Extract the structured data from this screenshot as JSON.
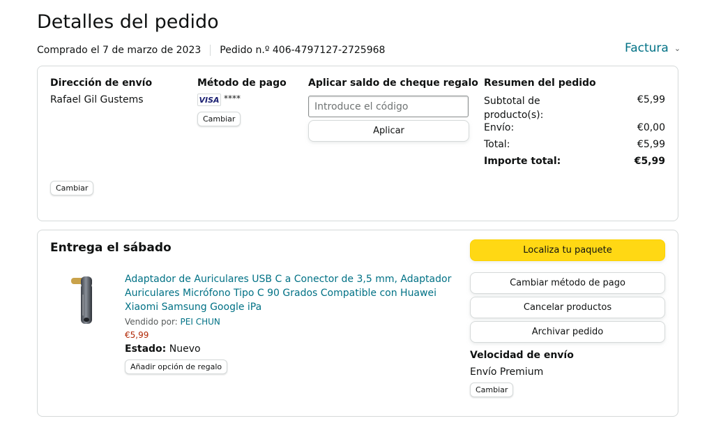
{
  "header": {
    "title": "Detalles del pedido",
    "purchased": "Comprado el 7 de marzo de 2023",
    "order_number": "Pedido n.º 406-4797127-2725968",
    "invoice_label": "Factura"
  },
  "shipping": {
    "heading": "Dirección de envío",
    "name": "Rafael Gil Gustems",
    "change_label": "Cambiar"
  },
  "payment": {
    "heading": "Método de pago",
    "card_brand": "VISA",
    "card_mask": "****",
    "change_label": "Cambiar"
  },
  "gift_card": {
    "heading": "Aplicar saldo de cheque regalo",
    "placeholder": "Introduce el código",
    "apply_label": "Aplicar"
  },
  "summary": {
    "heading": "Resumen del pedido",
    "rows": [
      {
        "label": "Subtotal de producto(s):",
        "value": "€5,99"
      },
      {
        "label": "Envío:",
        "value": "€0,00"
      },
      {
        "label": "Total:",
        "value": "€5,99"
      },
      {
        "label": "Importe total:",
        "value": "€5,99"
      }
    ]
  },
  "delivery": {
    "title": "Entrega el sábado",
    "product": {
      "title": "Adaptador de Auriculares USB C a Conector de 3,5 mm, Adaptador Auriculares Micrófono Tipo C 90 Grados Compatible con Huawei Xiaomi Samsung Google iPa",
      "sold_by_label": "Vendido por:",
      "seller": "PEI CHUN",
      "price": "€5,99",
      "condition_label": "Estado:",
      "condition_value": "Nuevo",
      "gift_option_label": "Añadir opción de regalo"
    },
    "actions": {
      "track": "Localiza tu paquete",
      "change_payment": "Cambiar método de pago",
      "cancel": "Cancelar productos",
      "archive": "Archivar pedido"
    },
    "speed": {
      "heading": "Velocidad de envío",
      "value": "Envío Premium",
      "change_label": "Cambiar"
    }
  },
  "colors": {
    "link": "#007185",
    "price": "#b12704",
    "primary_button": "#ffd814",
    "border": "#d5d9d9"
  }
}
